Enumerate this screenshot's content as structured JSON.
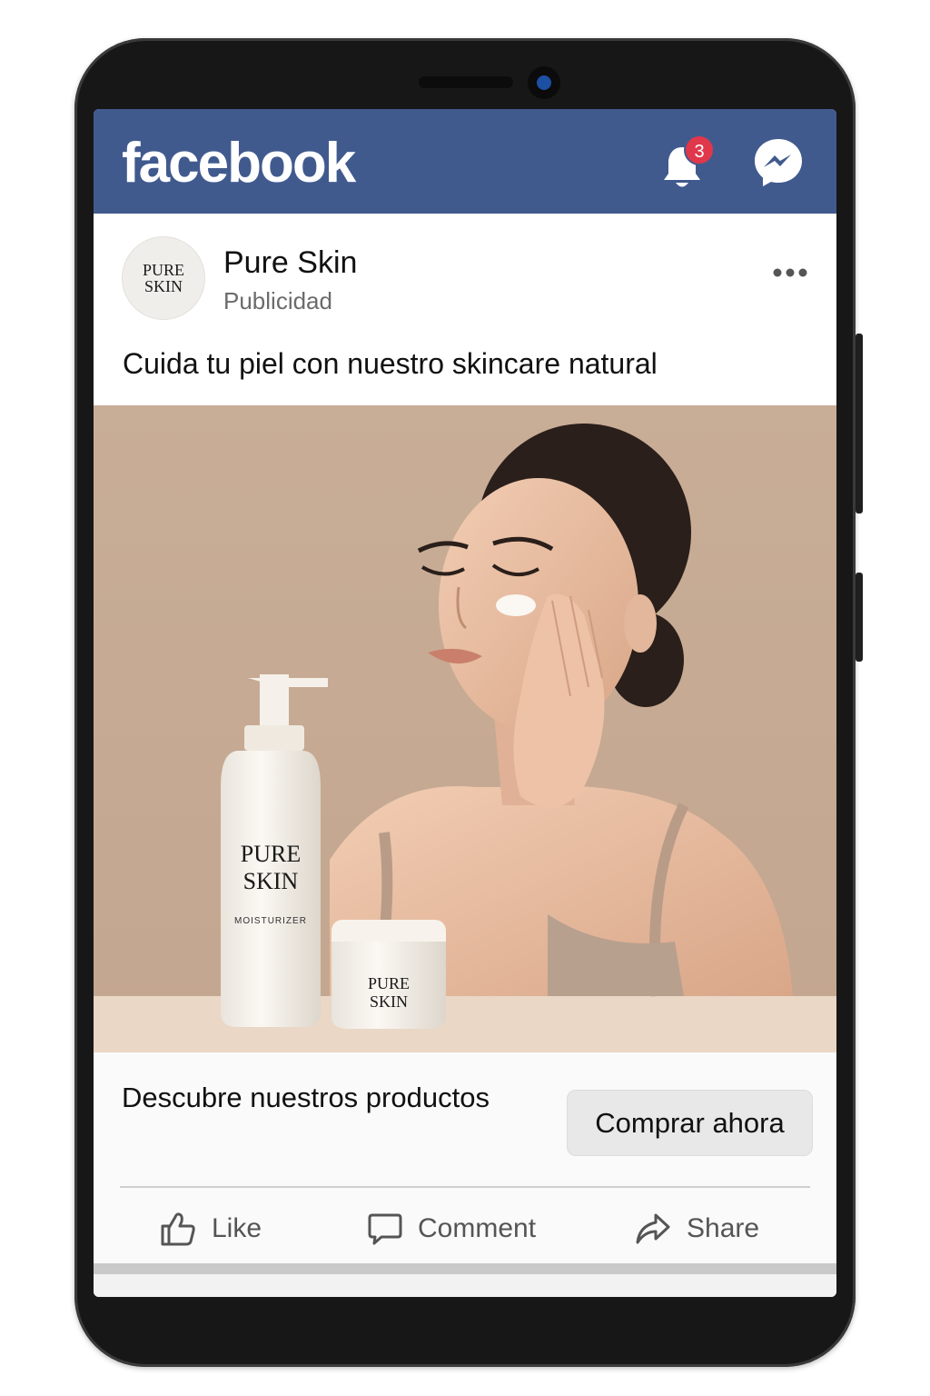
{
  "topbar": {
    "logo": "facebook",
    "notification_count": "3",
    "bell_icon": "bell-icon",
    "messenger_icon": "messenger-icon",
    "color": "#415a8e"
  },
  "post": {
    "page_name": "Pure Skin",
    "sponsored_label": "Publicidad",
    "avatar_text_line1": "PURE",
    "avatar_text_line2": "SKIN",
    "caption": "Cuida tu piel con nuestro skincare natural",
    "more_icon": "more-options-icon"
  },
  "ad_image": {
    "bottle_brand_line1": "PURE",
    "bottle_brand_line2": "SKIN",
    "bottle_product": "MOISTURIZER",
    "jar_brand_line1": "PURE",
    "jar_brand_line2": "SKIN",
    "background_color": "#c9ac95"
  },
  "cta": {
    "headline": "Descubre nuestros productos",
    "button_label": "Comprar ahora"
  },
  "actions": {
    "like_label": "Like",
    "comment_label": "Comment",
    "share_label": "Share"
  }
}
